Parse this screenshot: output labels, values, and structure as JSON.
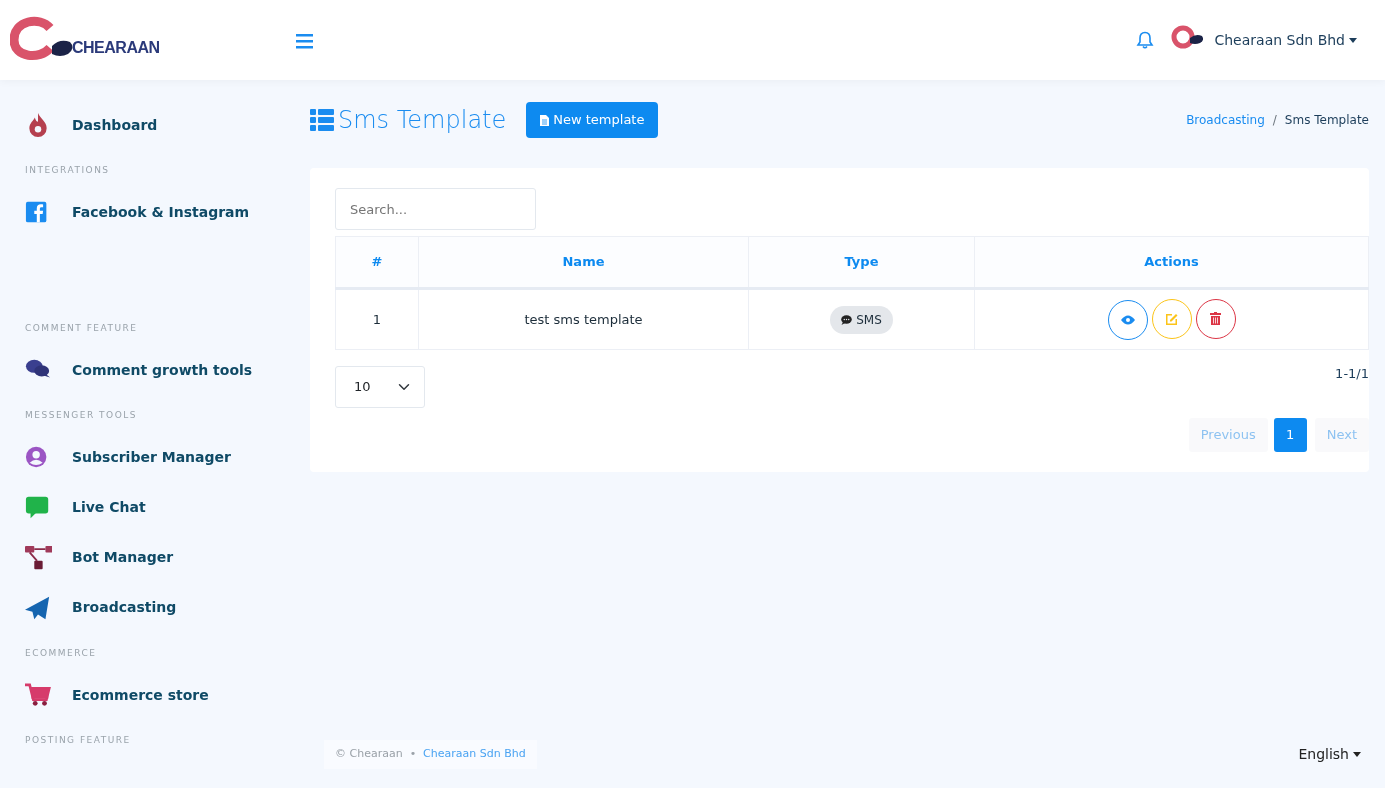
{
  "header": {
    "logo_text": "CHEARAAN",
    "account": "Chearaan Sdn Bhd"
  },
  "sidebar": {
    "sections": [
      {
        "items": [
          {
            "label": "Dashboard",
            "selected": false
          }
        ]
      },
      {
        "heading": "INTEGRATIONS",
        "items": [
          {
            "label": "Facebook & Instagram",
            "selected": false
          }
        ]
      },
      {
        "heading": "COMMENT FEATURE",
        "items": [
          {
            "label": "Comment growth tools",
            "selected": false
          }
        ]
      },
      {
        "heading": "MESSENGER TOOLS",
        "items": [
          {
            "label": "Subscriber Manager",
            "selected": false
          },
          {
            "label": "Live Chat",
            "selected": false
          },
          {
            "label": "Bot Manager",
            "selected": false
          },
          {
            "label": "Broadcasting",
            "selected": false
          }
        ]
      },
      {
        "heading": "ECOMMERCE",
        "items": [
          {
            "label": "Ecommerce store",
            "selected": false
          }
        ]
      },
      {
        "heading": "POSTING FEATURE"
      }
    ]
  },
  "page": {
    "title": "Sms Template",
    "new_button": "New template",
    "breadcrumb": [
      {
        "label": "Broadcasting",
        "link": true
      },
      {
        "label": "Sms Template",
        "link": false
      }
    ],
    "breadcrumb_separator": "/"
  },
  "table": {
    "search": {
      "placeholder": "Search..."
    },
    "columns": [
      "#",
      "Name",
      "Type",
      "Actions"
    ],
    "rows": [
      {
        "number": "1",
        "name": "test sms template",
        "type": "SMS"
      }
    ],
    "page_size": "10",
    "range": "1-1/1",
    "pagination": [
      {
        "label": "Previous",
        "selected": false,
        "disabled": true
      },
      {
        "label": "1",
        "selected": true,
        "disabled": false
      },
      {
        "label": "Next",
        "selected": false,
        "disabled": true
      }
    ]
  },
  "footer": {
    "copyright": "© Chearaan",
    "separator": "•",
    "company_link": "Chearaan Sdn Bhd",
    "language": "English"
  }
}
